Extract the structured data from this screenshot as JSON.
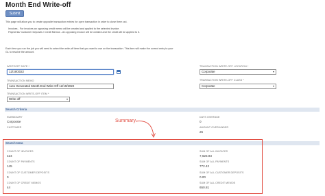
{
  "page": {
    "title": "Month End Write-off",
    "submit_label": "Submit"
  },
  "intro": {
    "line1": "This page will allow you to create opposite transaction entries for open transaction in order to close them out.",
    "bullet1": "Invoices - For invoices an opposing credit memo will be created and applied to the selected invoice.",
    "bullet2": "Payments/ Customer Deposits / Credit Memos - An opposing invoice will be created and the credit will be applied to it.",
    "line2": "Each time you run the job you will need to select the write-off item that you want to use on the transaction. This item will make the correct entry to your",
    "line3": "GL to resolve the amount."
  },
  "form": {
    "writeoff_date_label": "Writeoff Date *",
    "writeoff_date_value": "12/19/2022",
    "transaction_memo_label": "Transaction Memo",
    "transaction_memo_value": "Auto Generated Month End Write-Off 12/19/2022",
    "writeoff_item_label": "Transaction Write-off Item *",
    "writeoff_item_value": "Write-off",
    "writeoff_location_label": "Transaction Write-off Location *",
    "writeoff_location_value": "Corporate",
    "writeoff_class_label": "Transaction Write-off Class *",
    "writeoff_class_value": "Corporate"
  },
  "search_criteria": {
    "header": "Search Criteria",
    "subsidiary_label": "Subsidiary",
    "subsidiary_value": "Corporate",
    "customer_label": "Customer",
    "customer_value": "",
    "days_overdue_label": "Days Overdue",
    "days_overdue_value": "0",
    "amount_label": "Amount Over/Under",
    "amount_value": "25"
  },
  "annotation": {
    "summary_label": "Summary",
    "accent_color": "#e0463a"
  },
  "search_data": {
    "header": "Search Data",
    "count_invoices_label": "Count of Invoices",
    "count_invoices_value": "424",
    "count_payments_label": "Count of Payments",
    "count_payments_value": "145",
    "count_deposits_label": "Count of Customer Deposits",
    "count_deposits_value": "0",
    "count_credit_memos_label": "Count of Credit Memos",
    "count_credit_memos_value": "44",
    "sum_invoices_label": "Sum of All Invoices",
    "sum_invoices_value": "7,625.93",
    "sum_payments_label": "Sum of All Payments",
    "sum_payments_value": "772.42",
    "sum_deposits_label": "Sum of All Customer Deposits",
    "sum_deposits_value": "0.00",
    "sum_credit_memos_label": "Sum of All Credit Memos",
    "sum_credit_memos_value": "650.81"
  }
}
